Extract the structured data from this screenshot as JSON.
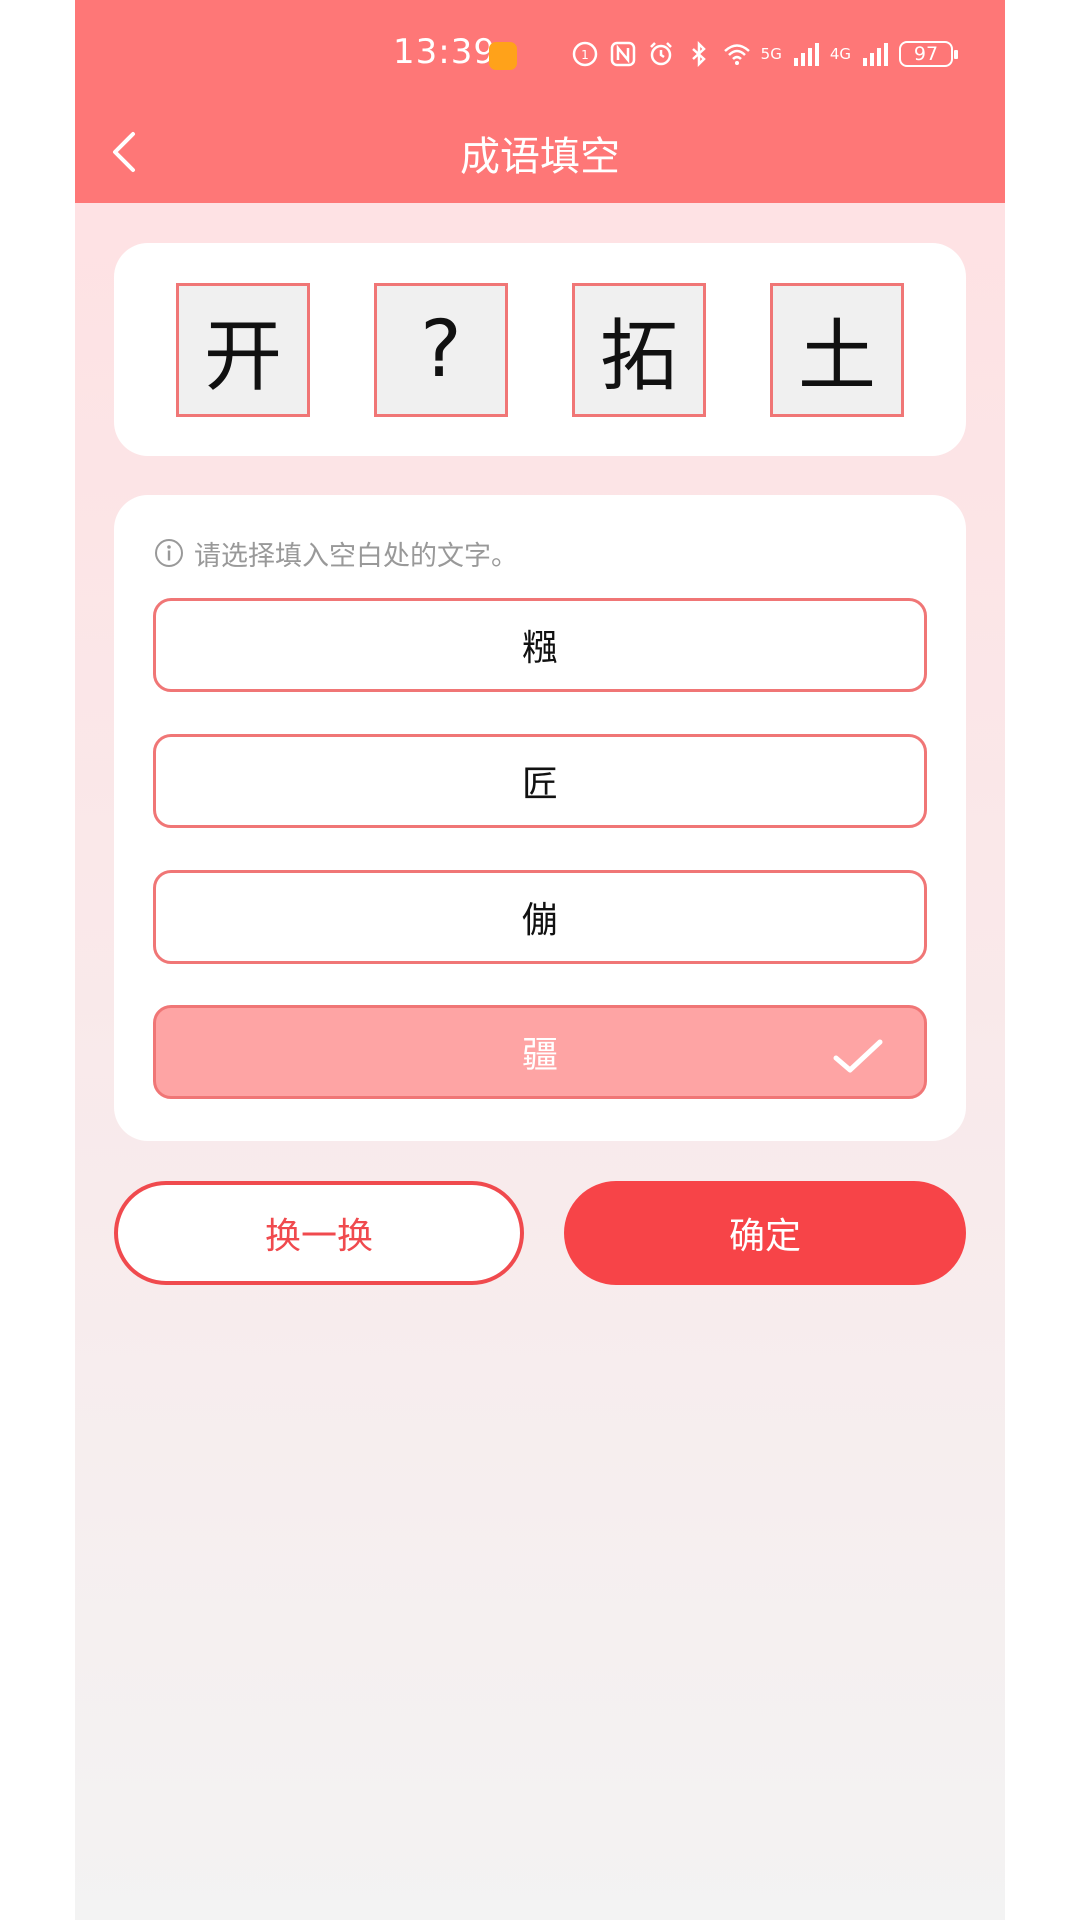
{
  "status_bar": {
    "time": "13:39",
    "net1": "5G",
    "net2": "4G",
    "battery": "97"
  },
  "header": {
    "title": "成语填空"
  },
  "idiom": {
    "chars": [
      "开",
      "?",
      "拓",
      "土"
    ]
  },
  "choices": {
    "hint": "请选择填入空白处的文字。",
    "options": [
      "糨",
      "匠",
      "傰",
      "疆"
    ],
    "selected_index": 3
  },
  "actions": {
    "swap_label": "换一换",
    "confirm_label": "确定"
  },
  "colors": {
    "header": "#fe7777",
    "accent_border": "#f07676",
    "selected_option": "#fea4a4",
    "confirm": "#f74448"
  }
}
